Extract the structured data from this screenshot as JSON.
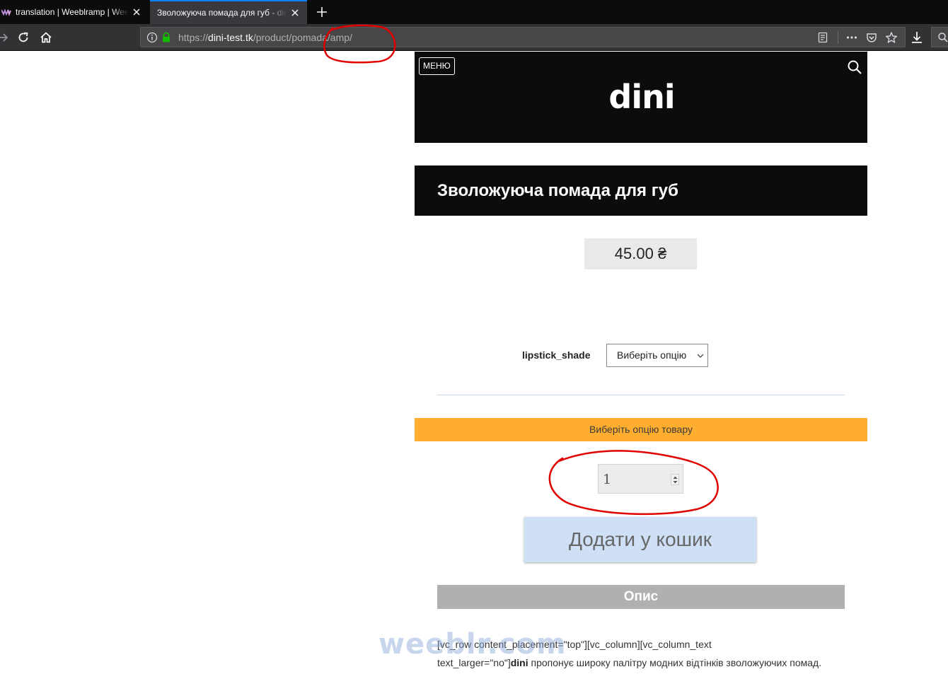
{
  "browser": {
    "tabs": [
      {
        "title": "translation | Weeblramp | Weebl",
        "active": false
      },
      {
        "title": "Зволожуюча помада для губ - dini",
        "active": true
      }
    ],
    "url": {
      "scheme": "https://",
      "host": "dini-test.tk",
      "path": "/product/pomada/amp/"
    }
  },
  "header": {
    "menu_label": "МЕНЮ",
    "logo_text": "dini"
  },
  "product": {
    "title": "Зволожуюча помада для губ",
    "price": "45.00 ₴",
    "variation": {
      "label": "lipstick_shade",
      "selected": "Виберіть опцію"
    },
    "notice": "Виберіть опцію товару",
    "quantity": "1",
    "add_to_cart_label": "Додати у кошик"
  },
  "description": {
    "tab_label": "Опис",
    "line1": "[vc_row content_placement=\"top\"][vc_column][vc_column_text",
    "line2_prefix": "text_larger=\"no\"]",
    "line2_bold": "dini",
    "line2_suffix": " пропонує широку палітру модних відтінків зволожуючих помад."
  },
  "watermark": "weeblr.com",
  "colors": {
    "notice_bg": "#ffad2e",
    "header_bg": "#0c0c0c",
    "cart_button_bg": "#cfdff6",
    "annotation": "#e00000",
    "tab_accent": "#0a84ff"
  }
}
